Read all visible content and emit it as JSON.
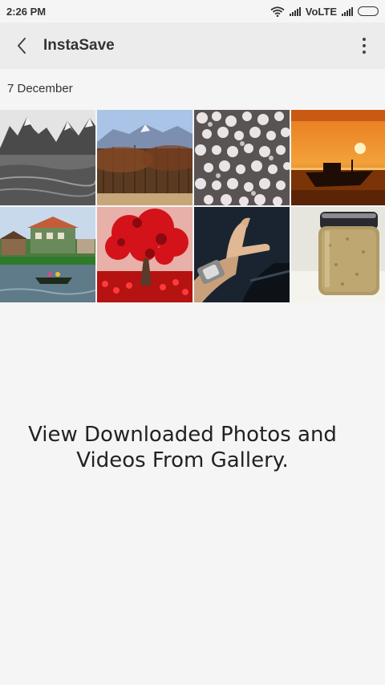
{
  "status_bar": {
    "time": "2:26 PM",
    "network_label": "VoLTE",
    "icons": [
      "wifi-icon",
      "signal-icon",
      "signal-icon",
      "battery-icon"
    ]
  },
  "app_bar": {
    "title": "InstaSave",
    "back_icon": "back-arrow-icon",
    "menu_icon": "overflow-menu-icon"
  },
  "gallery": {
    "date_header": "7 December",
    "items": [
      {
        "subject": "snowy-mountain-lake"
      },
      {
        "subject": "autumn-trees-mountains"
      },
      {
        "subject": "white-blossoms"
      },
      {
        "subject": "sunset-boat"
      },
      {
        "subject": "houseboat-river"
      },
      {
        "subject": "red-tree"
      },
      {
        "subject": "hand-with-watch"
      },
      {
        "subject": "jar"
      }
    ]
  },
  "message": {
    "line1": "View Downloaded Photos and",
    "line2": "Videos From Gallery."
  }
}
